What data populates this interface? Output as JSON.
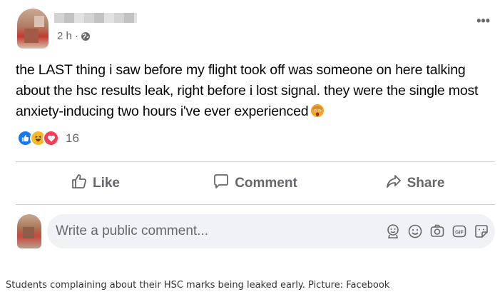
{
  "post": {
    "timestamp": "2 h ·",
    "more_label": "•••",
    "text": "the LAST thing i saw before my flight took off was someone on here talking about the hsc results leak, right before i lost signal. they were the single most anxiety-inducing two hours i've ever experienced",
    "inline_emoji": "fearful-face-emoji",
    "reactions": {
      "types": [
        "like",
        "haha",
        "love"
      ],
      "count": "16"
    }
  },
  "actions": {
    "like_label": "Like",
    "comment_label": "Comment",
    "share_label": "Share"
  },
  "comment_composer": {
    "placeholder": "Write a public comment...",
    "tools": [
      "avatar-sticker-icon",
      "emoji-icon",
      "camera-icon",
      "gif-icon",
      "sticker-icon"
    ]
  },
  "caption": "Students complaining about their HSC marks being leaked early. Picture: Facebook",
  "colors": {
    "text": "#050505",
    "secondary": "#65676b",
    "like_blue": "#1877f2",
    "love_red": "#f33e58",
    "haha_yellow": "#f7b928",
    "composer_bg": "#f0f2f5"
  }
}
